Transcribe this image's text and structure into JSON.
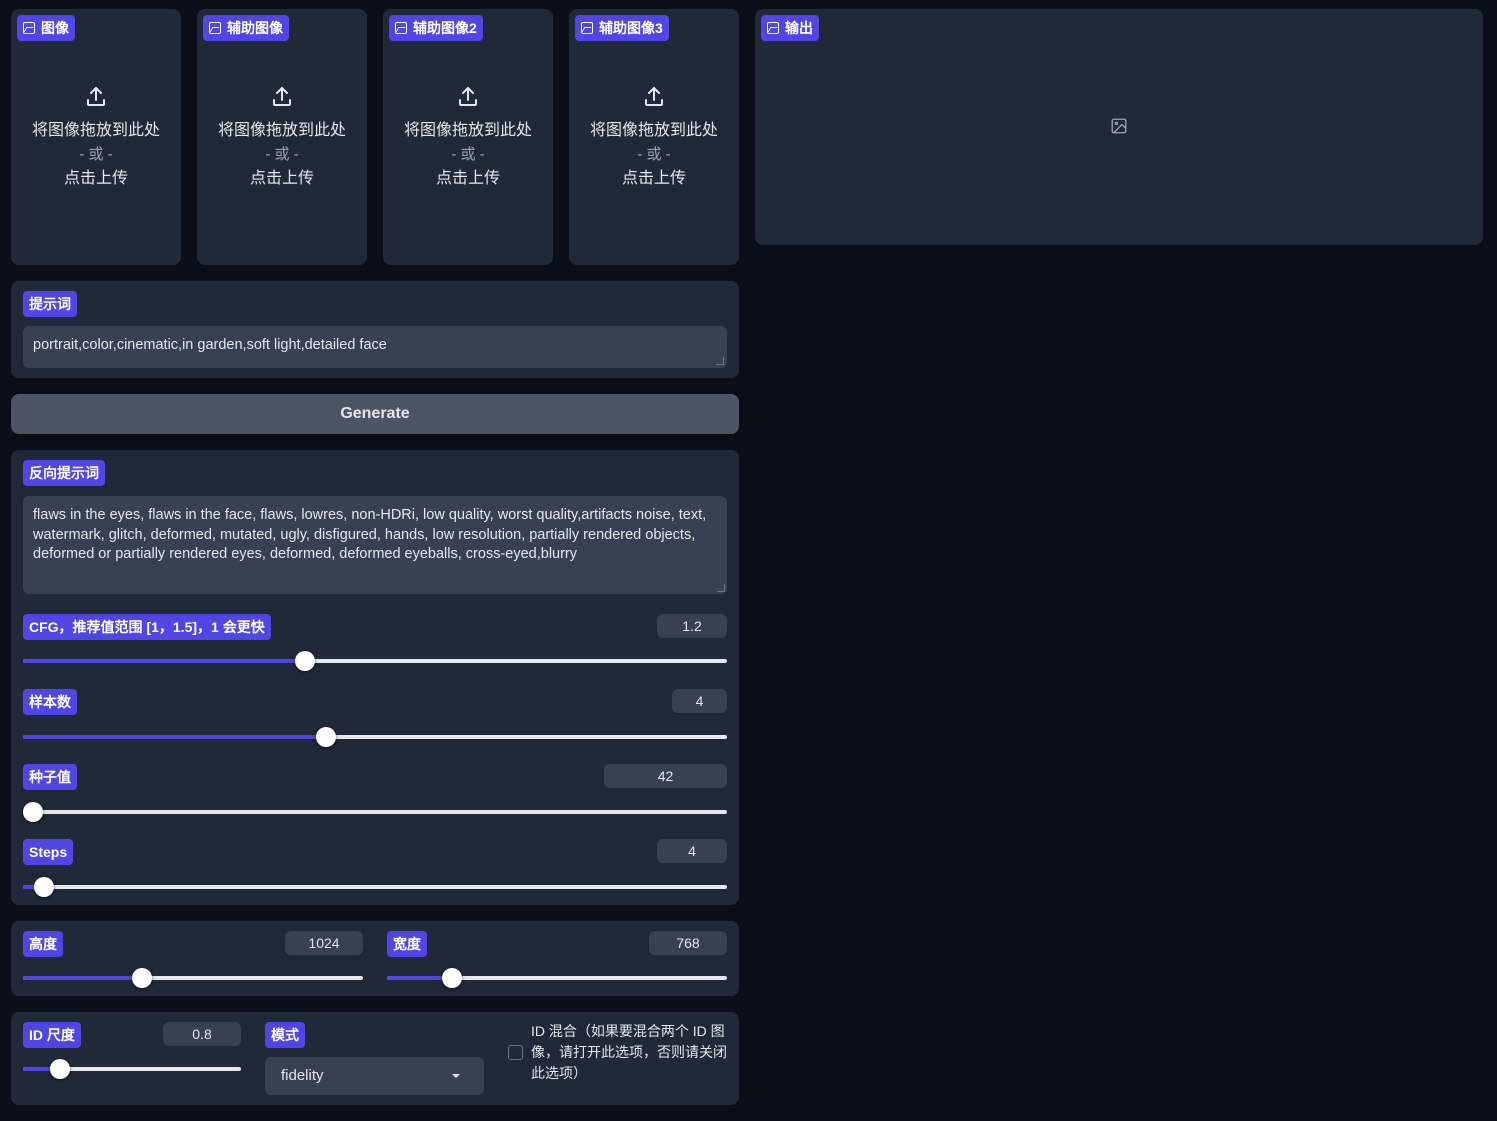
{
  "image_inputs": [
    {
      "label": "图像",
      "drop_text": "将图像拖放到此处",
      "or_text": "- 或 -",
      "click_text": "点击上传"
    },
    {
      "label": "辅助图像",
      "drop_text": "将图像拖放到此处",
      "or_text": "- 或 -",
      "click_text": "点击上传"
    },
    {
      "label": "辅助图像2",
      "drop_text": "将图像拖放到此处",
      "or_text": "- 或 -",
      "click_text": "点击上传"
    },
    {
      "label": "辅助图像3",
      "drop_text": "将图像拖放到此处",
      "or_text": "- 或 -",
      "click_text": "点击上传"
    }
  ],
  "output": {
    "label": "输出",
    "icon": "image-placeholder-icon"
  },
  "prompt": {
    "label": "提示词",
    "value": "portrait,color,cinematic,in garden,soft light,detailed face"
  },
  "generate_label": "Generate",
  "negative_prompt": {
    "label": "反向提示词",
    "value": "flaws in the eyes, flaws in the face, flaws, lowres, non-HDRi, low quality, worst quality,artifacts noise, text, watermark, glitch, deformed, mutated, ugly, disfigured, hands, low resolution, partially rendered objects,  deformed or partially rendered eyes, deformed, deformed eyeballs, cross-eyed,blurry"
  },
  "sliders": {
    "cfg": {
      "label": "CFG，推荐值范围 [1，1.5]，1 会更快",
      "value": "1.2",
      "fraction": 0.4
    },
    "samples": {
      "label": "样本数",
      "value": "4",
      "fraction": 0.43
    },
    "seed": {
      "label": "种子值",
      "value": "42",
      "fraction": 0.0
    },
    "steps": {
      "label": "Steps",
      "value": "4",
      "fraction": 0.03
    },
    "height": {
      "label": "高度",
      "value": "1024",
      "fraction": 0.35
    },
    "width": {
      "label": "宽度",
      "value": "768",
      "fraction": 0.19
    },
    "id_scale": {
      "label": "ID 尺度",
      "value": "0.8",
      "fraction": 0.17
    }
  },
  "mode": {
    "label": "模式",
    "selected": "fidelity"
  },
  "id_mix": {
    "label": "ID 混合（如果要混合两个 ID 图像，请打开此选项，否则请关闭此选项）",
    "checked": false
  },
  "colors": {
    "accent": "#4f46e5",
    "panel": "#1f2937",
    "background": "#0b0f19"
  }
}
